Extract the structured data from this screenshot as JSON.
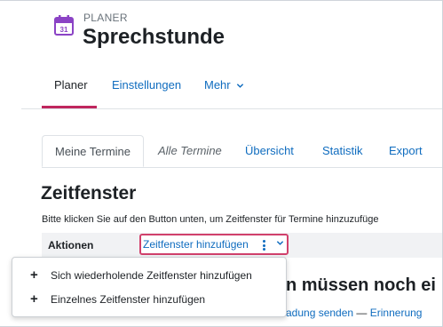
{
  "header": {
    "kicker": "PLANER",
    "title": "Sprechstunde",
    "icon": "calendar-icon",
    "icon_number": "31",
    "icon_color": "#8b43c5"
  },
  "primary_nav": {
    "items": [
      {
        "label": "Planer",
        "active": true
      },
      {
        "label": "Einstellungen",
        "active": false
      },
      {
        "label": "Mehr",
        "active": false
      }
    ],
    "active_color": "#c0265e"
  },
  "tabs": {
    "items": [
      {
        "label": "Meine Termine"
      },
      {
        "label": "Alle Termine"
      },
      {
        "label": "Übersicht"
      },
      {
        "label": "Statistik"
      },
      {
        "label": "Export"
      }
    ]
  },
  "section": {
    "heading": "Zeitfenster",
    "instructions": "Bitte klicken Sie auf den Button unten, um Zeitfenster für Termine hinzuzufüge"
  },
  "actions": {
    "label": "Aktionen",
    "button_label": "Zeitfenster hinzufügen",
    "focus_color": "#d1416c"
  },
  "dropdown": {
    "items": [
      {
        "label": "Sich wiederholende Zeitfenster hinzufügen"
      },
      {
        "label": "Einzelnes Zeitfenster hinzufügen"
      }
    ]
  },
  "background": {
    "heading": "n müssen noch ei",
    "link1": "adung senden",
    "separator": "—",
    "link2": "Erinnerung"
  },
  "colors": {
    "link": "#0f6cbf",
    "text": "#1d2125",
    "action_bar_bg": "#f1f2f4"
  }
}
